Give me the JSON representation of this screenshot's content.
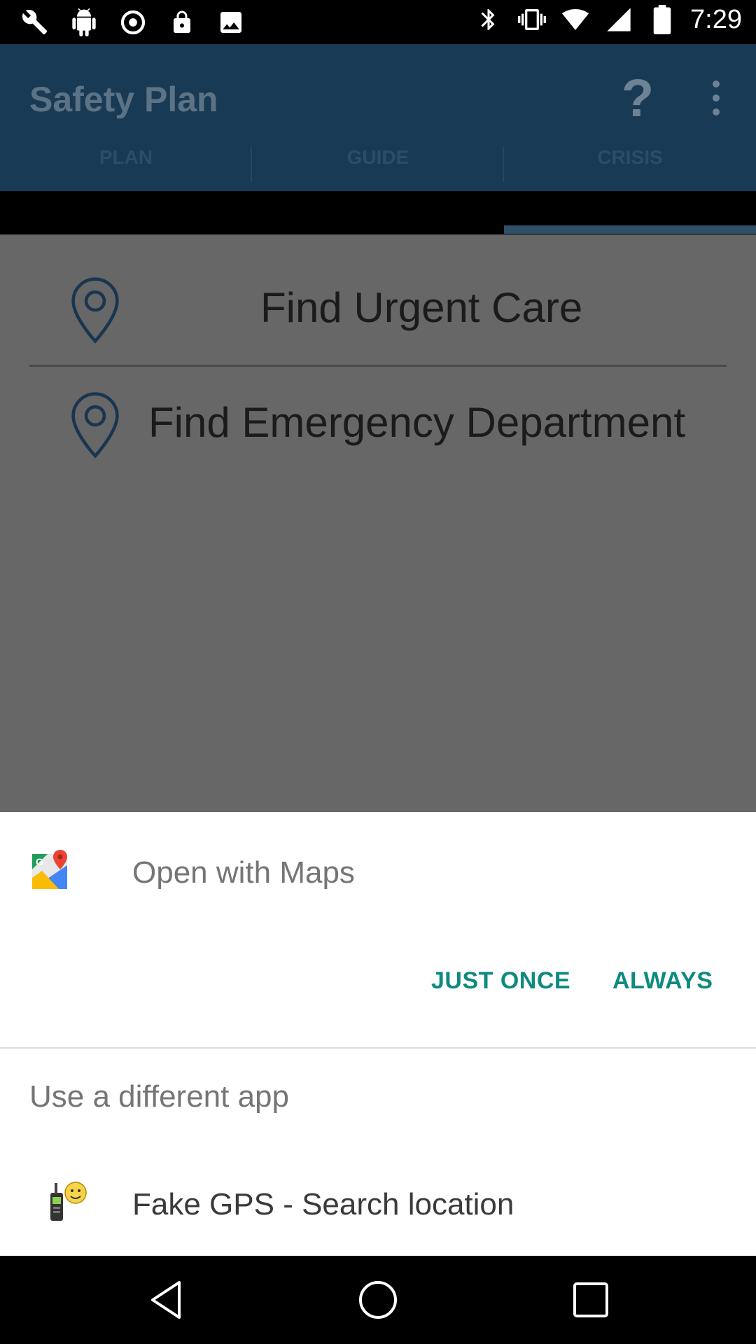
{
  "status_bar": {
    "time": "7:29",
    "left_icons": [
      "wrench-icon",
      "android-icon",
      "data-saver-icon",
      "lock-icon",
      "photo-icon"
    ],
    "right_icons": [
      "bluetooth-icon",
      "vibrate-icon",
      "wifi-icon",
      "signal-icon",
      "battery-icon"
    ]
  },
  "app_bar": {
    "title": "Safety Plan",
    "help_glyph": "?"
  },
  "tabs": [
    {
      "label": "PLAN"
    },
    {
      "label": "GUIDE"
    },
    {
      "label": "CRISIS"
    }
  ],
  "crisis": {
    "items": [
      {
        "label": "Find Urgent Care"
      },
      {
        "label": "Find Emergency Department"
      }
    ]
  },
  "chooser": {
    "title": "Open with Maps",
    "just_once": "JUST ONCE",
    "always": "ALWAYS",
    "different_app_label": "Use a different app",
    "alt_app": "Fake GPS - Search location"
  },
  "colors": {
    "app_bar": "#193a55",
    "accent": "#0f8a80",
    "scrim_content": "#676767"
  }
}
